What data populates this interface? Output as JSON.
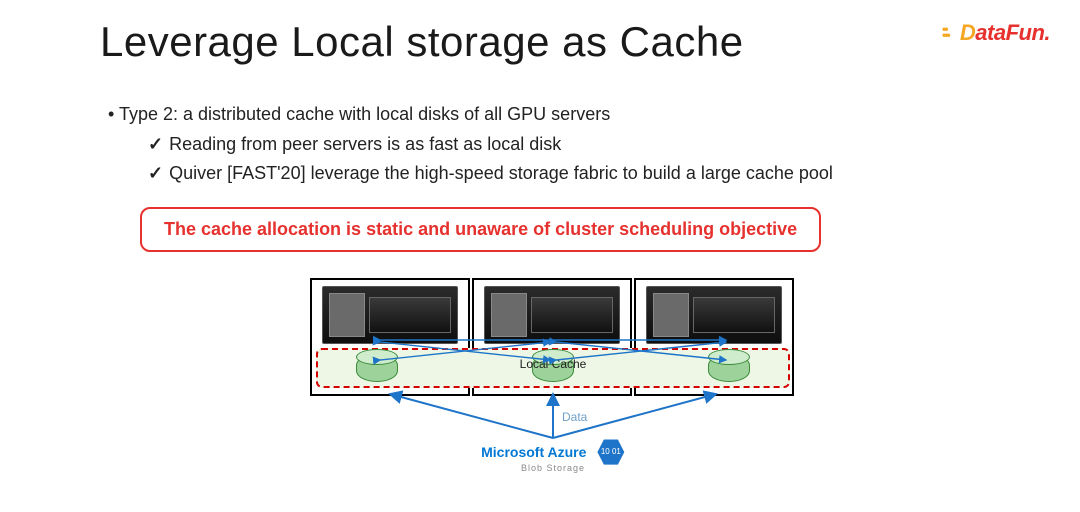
{
  "logo": {
    "text_part1": "D",
    "text_part2": "ataFun."
  },
  "title": "Leverage Local storage as Cache",
  "bullets": {
    "type2": "Type 2: a distributed cache with local disks of all GPU servers",
    "sub1": "Reading from peer servers is as fast as local disk",
    "sub2": "Quiver [FAST'20] leverage the high-speed storage fabric to build a large cache pool"
  },
  "callout": "The cache allocation is static and unaware of cluster scheduling objective",
  "diagram": {
    "cache_label": "Local Cache",
    "data_label": "Data",
    "azure_line1": "Microsoft Azure",
    "azure_line2": "Blob Storage",
    "hex_text": "10\n01"
  }
}
